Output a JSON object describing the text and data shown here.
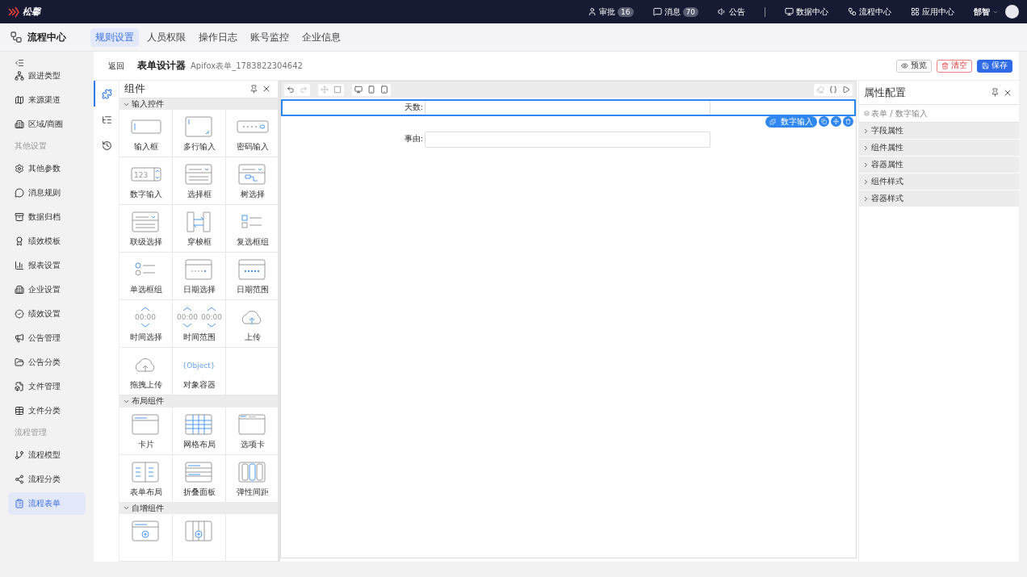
{
  "topbar": {
    "logo": "松馨",
    "items": [
      {
        "kind": "approve",
        "label": "审批",
        "badge": "16"
      },
      {
        "kind": "message",
        "label": "消息",
        "badge": "70"
      },
      {
        "kind": "notice",
        "label": "公告"
      },
      {
        "kind": "data",
        "label": "数据中心"
      },
      {
        "kind": "flow",
        "label": "流程中心"
      },
      {
        "kind": "apps",
        "label": "应用中心"
      }
    ],
    "user": "郜智"
  },
  "subnav": {
    "title": "流程中心",
    "tabs": [
      {
        "label": "规则设置",
        "selected": true
      },
      {
        "label": "人员权限",
        "selected": false
      },
      {
        "label": "操作日志",
        "selected": false
      },
      {
        "label": "账号监控",
        "selected": false
      },
      {
        "label": "企业信息",
        "selected": false
      }
    ]
  },
  "sidebar": {
    "items": [
      {
        "kind": "item",
        "label": "跟进类型",
        "selected": false
      },
      {
        "kind": "item",
        "label": "来源渠道",
        "selected": false
      },
      {
        "kind": "item",
        "label": "区域/商圈",
        "selected": false
      },
      {
        "kind": "section",
        "label": "其他设置"
      },
      {
        "kind": "item",
        "label": "其他参数",
        "selected": false
      },
      {
        "kind": "item",
        "label": "消息规则",
        "selected": false
      },
      {
        "kind": "item",
        "label": "数据归档",
        "selected": false
      },
      {
        "kind": "item",
        "label": "绩效模板",
        "selected": false
      },
      {
        "kind": "item",
        "label": "报表设置",
        "selected": false
      },
      {
        "kind": "item",
        "label": "企业设置",
        "selected": false
      },
      {
        "kind": "item",
        "label": "绩效设置",
        "selected": false
      },
      {
        "kind": "item",
        "label": "公告管理",
        "selected": false
      },
      {
        "kind": "item",
        "label": "公告分类",
        "selected": false
      },
      {
        "kind": "item",
        "label": "文件管理",
        "selected": false
      },
      {
        "kind": "item",
        "label": "文件分类",
        "selected": false
      },
      {
        "kind": "section",
        "label": "流程管理"
      },
      {
        "kind": "item",
        "label": "流程模型",
        "selected": false
      },
      {
        "kind": "item",
        "label": "流程分类",
        "selected": false
      },
      {
        "kind": "item",
        "label": "流程表单",
        "selected": true
      }
    ]
  },
  "header": {
    "back": "返回",
    "title": "表单设计器",
    "subtitle": "Apifox表单_1783822304642",
    "buttons": [
      {
        "kind": "preview",
        "label": "预览"
      },
      {
        "kind": "clear",
        "label": "清空"
      },
      {
        "kind": "save",
        "label": "保存"
      }
    ]
  },
  "rail": [
    {
      "kind": "components",
      "selected": true
    },
    {
      "kind": "outline",
      "selected": false
    },
    {
      "kind": "history",
      "selected": false
    }
  ],
  "components": {
    "title": "组件",
    "groups": [
      {
        "label": "输入控件",
        "expanded": true,
        "items": [
          {
            "kind": "input",
            "label": "输入框"
          },
          {
            "kind": "textarea",
            "label": "多行输入"
          },
          {
            "kind": "password",
            "label": "密码输入"
          },
          {
            "kind": "number",
            "label": "数字输入",
            "icon_text": "123"
          },
          {
            "kind": "select",
            "label": "选择框"
          },
          {
            "kind": "tree",
            "label": "树选择"
          },
          {
            "kind": "cascader",
            "label": "联级选择"
          },
          {
            "kind": "transfer",
            "label": "穿梭框"
          },
          {
            "kind": "checkbox",
            "label": "复选框组"
          },
          {
            "kind": "radio",
            "label": "单选框组"
          },
          {
            "kind": "date",
            "label": "日期选择"
          },
          {
            "kind": "daterange",
            "label": "日期范围"
          },
          {
            "kind": "time",
            "label": "时间选择",
            "icon_text": "00:00"
          },
          {
            "kind": "timerange",
            "label": "时间范围",
            "icon_texts": [
              "00:00",
              "00:00"
            ]
          },
          {
            "kind": "upload",
            "label": "上传"
          },
          {
            "kind": "dragupload",
            "label": "拖拽上传"
          },
          {
            "kind": "object",
            "label": "对象容器",
            "icon_text": "{Object}"
          }
        ]
      },
      {
        "label": "布局组件",
        "expanded": true,
        "items": [
          {
            "kind": "card",
            "label": "卡片"
          },
          {
            "kind": "grid",
            "label": "网格布局"
          },
          {
            "kind": "tabs",
            "label": "选项卡"
          },
          {
            "kind": "formlayout",
            "label": "表单布局"
          },
          {
            "kind": "collapse",
            "label": "折叠面板"
          },
          {
            "kind": "flex",
            "label": "弹性间距"
          }
        ]
      },
      {
        "label": "自增组件",
        "expanded": true,
        "items": [
          {
            "kind": "addcard"
          },
          {
            "kind": "addgrid"
          }
        ]
      }
    ]
  },
  "toolbar": {
    "left": [
      [
        {
          "kind": "undo",
          "disabled": false
        },
        {
          "kind": "redo",
          "disabled": true
        }
      ],
      [
        {
          "kind": "move",
          "disabled": true
        },
        {
          "kind": "select",
          "disabled": false
        }
      ],
      [
        {
          "kind": "desktop",
          "disabled": false
        },
        {
          "kind": "phone",
          "disabled": false
        },
        {
          "kind": "tablet",
          "disabled": false
        }
      ]
    ],
    "right": [
      {
        "kind": "clear",
        "disabled": true
      },
      {
        "kind": "code",
        "disabled": false
      },
      {
        "kind": "play",
        "disabled": false
      }
    ]
  },
  "form": {
    "fields": [
      {
        "label": "天数:",
        "selected": true
      },
      {
        "label": "事由:",
        "selected": false
      }
    ],
    "action": {
      "label": "数字输入"
    }
  },
  "properties": {
    "title": "属性配置",
    "breadcrumb": "表单 / 数字输入",
    "sections": [
      {
        "label": "字段属性",
        "expanded": false
      },
      {
        "label": "组件属性",
        "expanded": false
      },
      {
        "label": "容器属性",
        "expanded": false
      },
      {
        "label": "组件样式",
        "expanded": false
      },
      {
        "label": "容器样式",
        "expanded": false
      }
    ]
  }
}
